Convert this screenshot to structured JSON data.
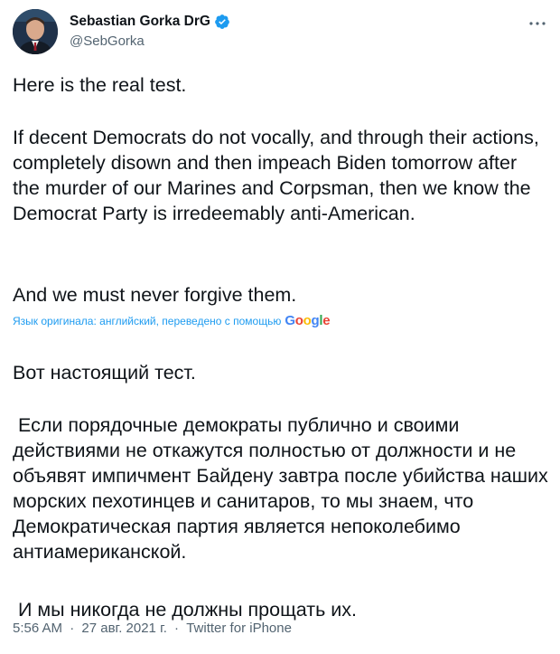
{
  "author": {
    "display_name": "Sebastian Gorka DrG",
    "handle": "@SebGorka",
    "verified": true,
    "avatar_icon": "avatar-portrait"
  },
  "tweet": {
    "line1": "Here is the real test.",
    "paragraph2": "If decent Democrats do not vocally, and through their actions, completely disown and then impeach Biden tomorrow after the murder of our Marines and Corpsman, then we know the Democrat Party is irredeemably anti-American.",
    "line3": "And we must never forgive them."
  },
  "translation": {
    "note": "Язык оригинала: английский, переведено с помощью",
    "provider": "Google",
    "line1": "Вот настоящий тест.",
    "paragraph2": " Если порядочные демократы публично и своими действиями не откажутся полностью от должности и не объявят импичмент Байдену завтра после убийства наших морских пехотинцев и санитаров, то мы знаем, что Демократическая партия является непоколебимо антиамериканской.",
    "line3": " И мы никогда не должны прощать их."
  },
  "meta": {
    "time": "5:56 AM",
    "separator1": "·",
    "date": "27 авг. 2021 г.",
    "separator2": "·",
    "source": "Twitter for iPhone"
  },
  "colors": {
    "text": "#0f1419",
    "secondary": "#536471",
    "accent": "#1d9bf0"
  }
}
